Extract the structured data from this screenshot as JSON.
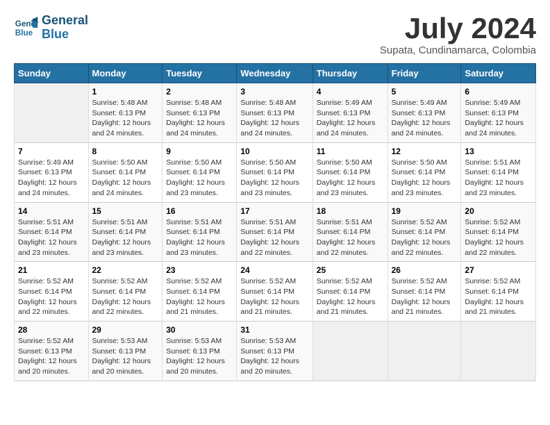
{
  "logo": {
    "line1": "General",
    "line2": "Blue"
  },
  "title": "July 2024",
  "location": "Supata, Cundinamarca, Colombia",
  "weekdays": [
    "Sunday",
    "Monday",
    "Tuesday",
    "Wednesday",
    "Thursday",
    "Friday",
    "Saturday"
  ],
  "weeks": [
    [
      {
        "num": "",
        "info": ""
      },
      {
        "num": "1",
        "info": "Sunrise: 5:48 AM\nSunset: 6:13 PM\nDaylight: 12 hours\nand 24 minutes."
      },
      {
        "num": "2",
        "info": "Sunrise: 5:48 AM\nSunset: 6:13 PM\nDaylight: 12 hours\nand 24 minutes."
      },
      {
        "num": "3",
        "info": "Sunrise: 5:48 AM\nSunset: 6:13 PM\nDaylight: 12 hours\nand 24 minutes."
      },
      {
        "num": "4",
        "info": "Sunrise: 5:49 AM\nSunset: 6:13 PM\nDaylight: 12 hours\nand 24 minutes."
      },
      {
        "num": "5",
        "info": "Sunrise: 5:49 AM\nSunset: 6:13 PM\nDaylight: 12 hours\nand 24 minutes."
      },
      {
        "num": "6",
        "info": "Sunrise: 5:49 AM\nSunset: 6:13 PM\nDaylight: 12 hours\nand 24 minutes."
      }
    ],
    [
      {
        "num": "7",
        "info": "Sunrise: 5:49 AM\nSunset: 6:13 PM\nDaylight: 12 hours\nand 24 minutes."
      },
      {
        "num": "8",
        "info": "Sunrise: 5:50 AM\nSunset: 6:14 PM\nDaylight: 12 hours\nand 24 minutes."
      },
      {
        "num": "9",
        "info": "Sunrise: 5:50 AM\nSunset: 6:14 PM\nDaylight: 12 hours\nand 23 minutes."
      },
      {
        "num": "10",
        "info": "Sunrise: 5:50 AM\nSunset: 6:14 PM\nDaylight: 12 hours\nand 23 minutes."
      },
      {
        "num": "11",
        "info": "Sunrise: 5:50 AM\nSunset: 6:14 PM\nDaylight: 12 hours\nand 23 minutes."
      },
      {
        "num": "12",
        "info": "Sunrise: 5:50 AM\nSunset: 6:14 PM\nDaylight: 12 hours\nand 23 minutes."
      },
      {
        "num": "13",
        "info": "Sunrise: 5:51 AM\nSunset: 6:14 PM\nDaylight: 12 hours\nand 23 minutes."
      }
    ],
    [
      {
        "num": "14",
        "info": "Sunrise: 5:51 AM\nSunset: 6:14 PM\nDaylight: 12 hours\nand 23 minutes."
      },
      {
        "num": "15",
        "info": "Sunrise: 5:51 AM\nSunset: 6:14 PM\nDaylight: 12 hours\nand 23 minutes."
      },
      {
        "num": "16",
        "info": "Sunrise: 5:51 AM\nSunset: 6:14 PM\nDaylight: 12 hours\nand 23 minutes."
      },
      {
        "num": "17",
        "info": "Sunrise: 5:51 AM\nSunset: 6:14 PM\nDaylight: 12 hours\nand 22 minutes."
      },
      {
        "num": "18",
        "info": "Sunrise: 5:51 AM\nSunset: 6:14 PM\nDaylight: 12 hours\nand 22 minutes."
      },
      {
        "num": "19",
        "info": "Sunrise: 5:52 AM\nSunset: 6:14 PM\nDaylight: 12 hours\nand 22 minutes."
      },
      {
        "num": "20",
        "info": "Sunrise: 5:52 AM\nSunset: 6:14 PM\nDaylight: 12 hours\nand 22 minutes."
      }
    ],
    [
      {
        "num": "21",
        "info": "Sunrise: 5:52 AM\nSunset: 6:14 PM\nDaylight: 12 hours\nand 22 minutes."
      },
      {
        "num": "22",
        "info": "Sunrise: 5:52 AM\nSunset: 6:14 PM\nDaylight: 12 hours\nand 22 minutes."
      },
      {
        "num": "23",
        "info": "Sunrise: 5:52 AM\nSunset: 6:14 PM\nDaylight: 12 hours\nand 21 minutes."
      },
      {
        "num": "24",
        "info": "Sunrise: 5:52 AM\nSunset: 6:14 PM\nDaylight: 12 hours\nand 21 minutes."
      },
      {
        "num": "25",
        "info": "Sunrise: 5:52 AM\nSunset: 6:14 PM\nDaylight: 12 hours\nand 21 minutes."
      },
      {
        "num": "26",
        "info": "Sunrise: 5:52 AM\nSunset: 6:14 PM\nDaylight: 12 hours\nand 21 minutes."
      },
      {
        "num": "27",
        "info": "Sunrise: 5:52 AM\nSunset: 6:14 PM\nDaylight: 12 hours\nand 21 minutes."
      }
    ],
    [
      {
        "num": "28",
        "info": "Sunrise: 5:52 AM\nSunset: 6:13 PM\nDaylight: 12 hours\nand 20 minutes."
      },
      {
        "num": "29",
        "info": "Sunrise: 5:53 AM\nSunset: 6:13 PM\nDaylight: 12 hours\nand 20 minutes."
      },
      {
        "num": "30",
        "info": "Sunrise: 5:53 AM\nSunset: 6:13 PM\nDaylight: 12 hours\nand 20 minutes."
      },
      {
        "num": "31",
        "info": "Sunrise: 5:53 AM\nSunset: 6:13 PM\nDaylight: 12 hours\nand 20 minutes."
      },
      {
        "num": "",
        "info": ""
      },
      {
        "num": "",
        "info": ""
      },
      {
        "num": "",
        "info": ""
      }
    ]
  ]
}
